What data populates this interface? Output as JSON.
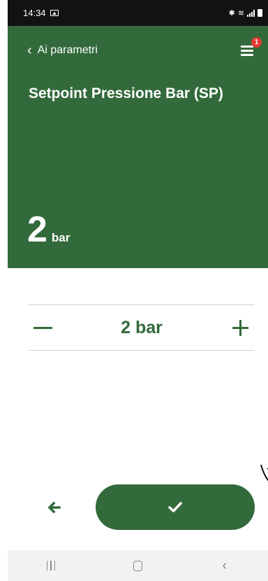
{
  "status_bar": {
    "time": "14:34",
    "icons": [
      "image-icon",
      "bluetooth-icon",
      "wifi-icon",
      "signal-icon",
      "battery-icon"
    ]
  },
  "header": {
    "back_label": "Ai parametri",
    "notification_count": "1",
    "title": "Setpoint Pressione Bar (SP)",
    "value": "2",
    "unit": "bar"
  },
  "stepper": {
    "value_text": "2 bar",
    "minus_label": "−",
    "plus_label": "+"
  },
  "actions": {
    "back_icon": "arrow-left-icon",
    "confirm_icon": "check-icon"
  },
  "nav_bar": {
    "buttons": [
      "recents",
      "home",
      "back"
    ]
  },
  "colors": {
    "primary": "#336a3b",
    "badge": "#e53935",
    "status_bar": "#121212",
    "nav_bar": "#f2f2f2"
  }
}
